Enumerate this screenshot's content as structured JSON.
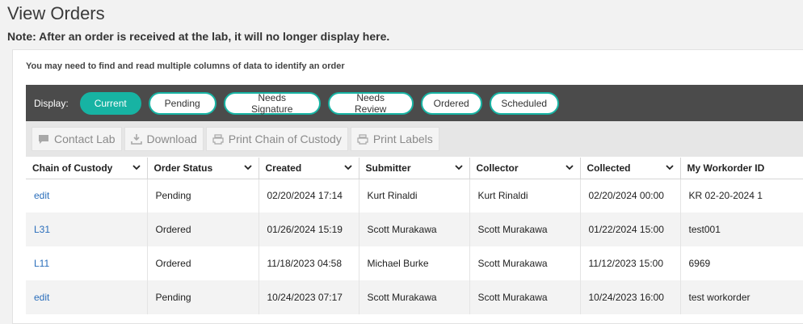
{
  "page": {
    "title": "View Orders",
    "note": "Note: After an order is received at the lab, it will no longer display here.",
    "hint": "You may need to find and read multiple columns of data to identify an order"
  },
  "display": {
    "label": "Display:",
    "filters": [
      "Current",
      "Pending",
      "Needs Signature",
      "Needs Review",
      "Ordered",
      "Scheduled"
    ],
    "active": "Current",
    "accent": "#17b3a3"
  },
  "toolbar": {
    "contact_lab": "Contact Lab",
    "download": "Download",
    "print_chain": "Print Chain of Custody",
    "print_labels": "Print Labels"
  },
  "table": {
    "columns": [
      "Chain of Custody",
      "Order Status",
      "Created",
      "Submitter",
      "Collector",
      "Collected",
      "My Workorder ID"
    ],
    "rows": [
      [
        "edit",
        "Pending",
        "02/20/2024 17:14",
        "Kurt Rinaldi",
        "Kurt Rinaldi",
        "02/20/2024 00:00",
        "KR 02-20-2024 1"
      ],
      [
        "L31",
        "Ordered",
        "01/26/2024 15:19",
        "Scott Murakawa",
        "Scott Murakawa",
        "01/22/2024 15:00",
        "test001"
      ],
      [
        "L11",
        "Ordered",
        "11/18/2023 04:58",
        "Michael Burke",
        "Scott Murakawa",
        "11/12/2023 15:00",
        "6969"
      ],
      [
        "edit",
        "Pending",
        "10/24/2023 07:17",
        "Scott Murakawa",
        "Scott Murakawa",
        "10/24/2023 16:00",
        "test workorder"
      ]
    ]
  }
}
